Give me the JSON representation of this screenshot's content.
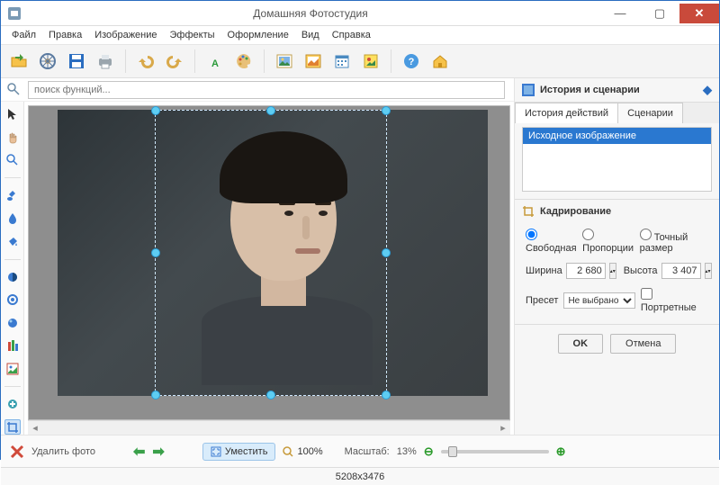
{
  "window": {
    "title": "Домашняя Фотостудия"
  },
  "menu": {
    "items": [
      "Файл",
      "Правка",
      "Изображение",
      "Эффекты",
      "Оформление",
      "Вид",
      "Справка"
    ]
  },
  "search": {
    "placeholder": "поиск функций..."
  },
  "rightTitle": "История и сценарии",
  "tabs": {
    "history": "История действий",
    "scenarios": "Сценарии"
  },
  "history": {
    "item0": "Исходное изображение"
  },
  "cropSection": "Кадрирование",
  "crop": {
    "modes": {
      "free": "Свободная",
      "ratio": "Пропорции",
      "exact": "Точный размер"
    },
    "widthLabel": "Ширина",
    "width": "2 680",
    "heightLabel": "Высота",
    "height": "3 407",
    "presetLabel": "Пресет",
    "presetValue": "Не выбрано",
    "portraitLabel": "Портретные",
    "ok": "OK",
    "cancel": "Отмена"
  },
  "bottom": {
    "delete": "Удалить фото",
    "fit": "Уместить",
    "zoom100": "100%",
    "zoomLabel": "Масштаб:",
    "zoomValue": "13%"
  },
  "status": {
    "dims": "5208x3476"
  }
}
